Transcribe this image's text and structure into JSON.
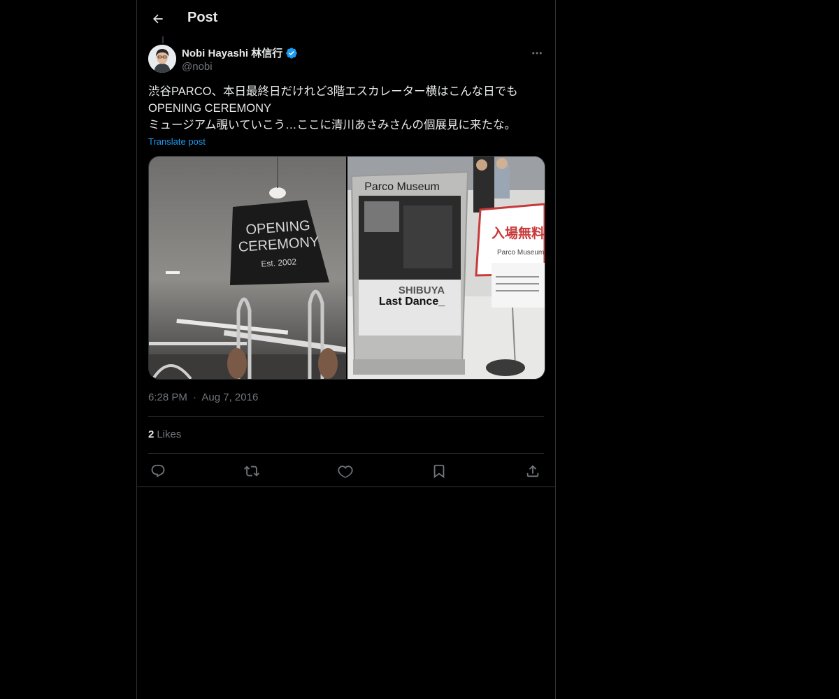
{
  "header": {
    "title": "Post"
  },
  "icons": {
    "back": "arrow-left-icon",
    "more": "more-horizontal-icon",
    "verified": "verified-badge-icon",
    "reply": "reply-icon",
    "repost": "repost-icon",
    "like": "heart-icon",
    "bookmark": "bookmark-icon",
    "share": "share-icon"
  },
  "author": {
    "name": "Nobi Hayashi 林信行",
    "handle": "@nobi",
    "verified": true
  },
  "post": {
    "lines": [
      "渋谷PARCO、本日最終日だけれど3階エスカレーター横はこんな日でも",
      "OPENING CEREMONY",
      "ミュージアム覗いていこう…ここに清川あさみさんの個展見に来たな。"
    ],
    "translate_label": "Translate post",
    "images": [
      {
        "alt": "OPENING CEREMONY sign hanging from ceiling",
        "sign_line1": "OPENING",
        "sign_line2": "CEREMONY",
        "sign_line3": "Est. 2002"
      },
      {
        "alt": "Parco Museum exhibition signboard",
        "board_title": "Parco Museum",
        "poster_line1": "SHIBUYA",
        "poster_line2": "Last Dance_",
        "notice_title": "入場無料",
        "notice_sub": "Parco Museum"
      }
    ],
    "time": "6:28 PM",
    "separator": "·",
    "date": "Aug 7, 2016"
  },
  "stats": {
    "likes_count": "2",
    "likes_label": "Likes"
  },
  "colors": {
    "background": "#000000",
    "text_primary": "#e7e9ea",
    "text_secondary": "#71767b",
    "accent": "#1d9bf0",
    "border": "#2f3336"
  }
}
